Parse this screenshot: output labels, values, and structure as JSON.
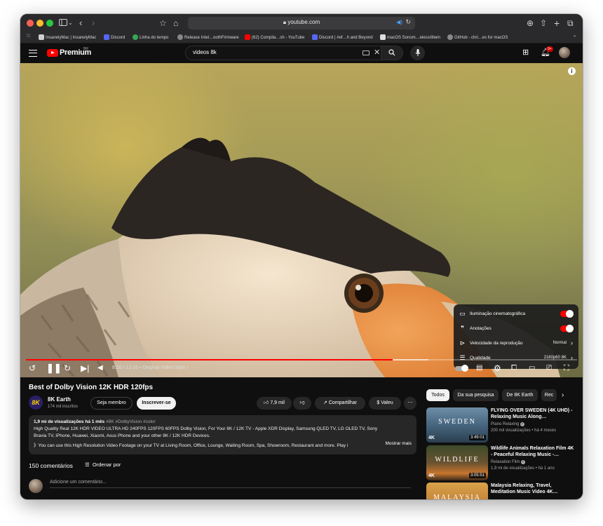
{
  "browser": {
    "url": "youtube.com",
    "bookmarks": [
      {
        "label": "InsanelyMac | InsanelyMac",
        "color": "#cfcfcf"
      },
      {
        "label": "Discord",
        "color": "#5865f2"
      },
      {
        "label": "Linha do tempo",
        "color": "#34a853"
      },
      {
        "label": "Release Intel…oothFirmware",
        "color": "#888888"
      },
      {
        "label": "(62) Compila…sh - YouTube",
        "color": "#ff0000"
      },
      {
        "label": "Discord | #ef…h and Beyond",
        "color": "#5865f2"
      },
      {
        "label": "macOS Sonom…eless/itlwm",
        "color": "#dddddd"
      },
      {
        "label": "GitHub - chri…es for macOS",
        "color": "#888888"
      }
    ]
  },
  "header": {
    "brand": "Premium",
    "country": "BR",
    "search_value": "videos 8k",
    "notifications": "9+"
  },
  "player": {
    "time_current": "8:10",
    "time_total": "12:16",
    "chapter": "• Original Video Start",
    "progress": 0.665,
    "buffered": 0.73,
    "settings": {
      "cinematic_label": "Iluminação cinematográfica",
      "cinematic_on": true,
      "annotations_label": "Anotações",
      "annotations_on": true,
      "speed_label": "Velocidade da reprodução",
      "speed_value": "Normal",
      "quality_label": "Qualidade",
      "quality_value": "2160p60 8K"
    }
  },
  "video": {
    "title": "Best of Dolby Vision 12K HDR 120fps",
    "channel": "8K Earth",
    "channel_avatar_text": "8K",
    "subscribers": "174 mil inscritos",
    "join_label": "Seja membro",
    "subscribe_label": "Inscrever-se",
    "likes": "7,9 mil",
    "share_label": "Compartilhar",
    "thanks_label": "Valeu",
    "views_date": "1,9 mi de visualizações  há 1 mês",
    "hashtags": "#8K #DolbyVision #color",
    "desc_line1": "High Quality Real 12K HDR VIDEO ULTRA HD 240FPS 120FPS 60FPS Dolby Vision, For Your 8K / 12K TV - Apple XDR Display, Samsung QLED TV, LG OLED TV, Sony",
    "desc_line2": "Bravia TV, iPhone, Huawei, Xiaomi, Asus Phone and your other 8K / 12K HDR Devices.",
    "desc_line3": "》You can use this High Resolution Video Footage on your TV at Living Room, Office, Lounge, Waiting Room, Spa, Showroom, Restaurant and more. Play i",
    "more_label": "Mostrar mais"
  },
  "comments": {
    "count": "150 comentários",
    "sort_label": "Ordenar por",
    "placeholder": "Adicione um comentário..."
  },
  "chips": [
    "Todos",
    "Da sua pesquisa",
    "De 8K Earth",
    "Rec"
  ],
  "recommendations": [
    {
      "title": "FLYING OVER SWEDEN (4K UHD) - Relaxing Music Along…",
      "channel": "Piano Relaxing",
      "meta": "200 mil visualizações • há 4 meses",
      "duration": "3:49:01",
      "thumb_text": "SWEDEN",
      "badge": "4K"
    },
    {
      "title": "Wildlife Animals Relaxation Film 4K - Peaceful Relaxing Music -…",
      "channel": "Relaxation Film",
      "meta": "1,9 mi de visualizações • há 1 ano",
      "duration": "3:05:51",
      "thumb_text": "WILDLIFE",
      "badge": "4K"
    },
    {
      "title": "Malaysia Relaxing, Travel, Meditation Music Video 4K…",
      "channel": "",
      "meta": "",
      "duration": "",
      "thumb_text": "MALAYSIA",
      "badge": ""
    }
  ]
}
